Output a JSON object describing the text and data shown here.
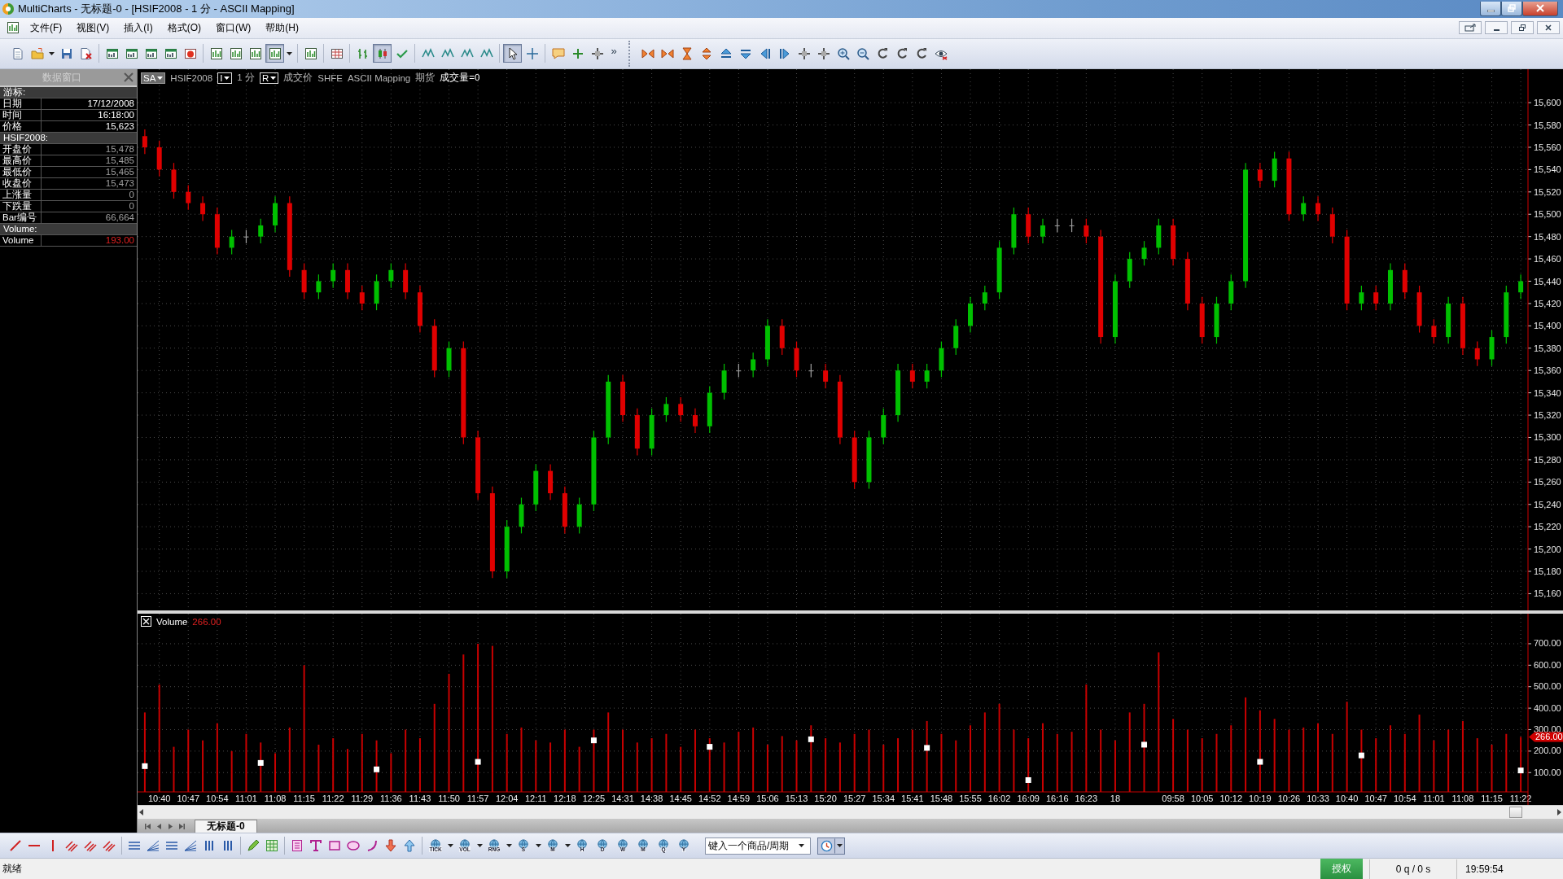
{
  "window": {
    "title": "MultiCharts - 无标题-0 - [HSIF2008 - 1 分 - ASCII Mapping]"
  },
  "menu": [
    "文件(F)",
    "视图(V)",
    "插入(I)",
    "格式(O)",
    "窗口(W)",
    "帮助(H)"
  ],
  "toolbars": [
    {
      "groups": [
        [
          {
            "kind": "document",
            "pressed": false
          },
          {
            "kind": "folder",
            "pressed": false
          },
          {
            "kind": "dropdown",
            "pressed": false
          },
          {
            "kind": "save",
            "pressed": false
          },
          {
            "kind": "close-doc",
            "pressed": false
          }
        ],
        [
          {
            "kind": "window",
            "pressed": false
          },
          {
            "kind": "window",
            "pressed": false
          },
          {
            "kind": "window",
            "pressed": false
          },
          {
            "kind": "window",
            "pressed": false
          },
          {
            "kind": "record",
            "pressed": false
          }
        ],
        [
          {
            "kind": "chart",
            "pressed": false
          },
          {
            "kind": "chart",
            "pressed": false
          },
          {
            "kind": "chart",
            "pressed": false
          },
          {
            "kind": "chart",
            "pressed": true
          },
          {
            "kind": "dropdown",
            "pressed": false
          }
        ],
        [
          {
            "kind": "chart",
            "pressed": false
          }
        ],
        [
          {
            "kind": "table",
            "pressed": false
          }
        ],
        [
          {
            "kind": "bars",
            "pressed": false
          },
          {
            "kind": "candles",
            "pressed": true
          },
          {
            "kind": "check",
            "pressed": false
          }
        ],
        [
          {
            "kind": "indicator",
            "pressed": false
          },
          {
            "kind": "indicator",
            "pressed": false
          },
          {
            "kind": "indicator",
            "pressed": false
          },
          {
            "kind": "indicator",
            "pressed": false
          }
        ],
        [
          {
            "kind": "pointer",
            "pressed": true
          },
          {
            "kind": "crosshair",
            "pressed": false
          }
        ],
        [
          {
            "kind": "comment",
            "pressed": false
          },
          {
            "kind": "plus",
            "pressed": false
          },
          {
            "kind": "move",
            "pressed": false
          },
          {
            "kind": "more",
            "label": "»",
            "pressed": false
          }
        ]
      ]
    },
    {
      "groups": [
        [
          {
            "kind": "arrows-in",
            "pressed": false
          },
          {
            "kind": "arrows-in",
            "pressed": false
          },
          {
            "kind": "hourglass",
            "pressed": false
          },
          {
            "kind": "expand",
            "pressed": false
          },
          {
            "kind": "up",
            "pressed": false
          },
          {
            "kind": "down",
            "pressed": false
          },
          {
            "kind": "left",
            "pressed": false
          },
          {
            "kind": "right",
            "pressed": false
          },
          {
            "kind": "move",
            "pressed": false
          },
          {
            "kind": "move",
            "pressed": false
          },
          {
            "kind": "zoom-in",
            "pressed": false
          },
          {
            "kind": "zoom-out",
            "pressed": false
          },
          {
            "kind": "rotate",
            "pressed": false
          },
          {
            "kind": "rotate",
            "pressed": false
          },
          {
            "kind": "rotate",
            "pressed": false
          },
          {
            "kind": "eye",
            "pressed": false
          }
        ]
      ]
    }
  ],
  "data_window": {
    "title": "数据窗口",
    "rows": [
      {
        "kind": "section",
        "label": "游标:"
      },
      {
        "kind": "row",
        "label": "日期",
        "value": "17/12/2008",
        "color": "#ffffff"
      },
      {
        "kind": "row",
        "label": "时间",
        "value": "16:18:00",
        "color": "#ffffff"
      },
      {
        "kind": "row",
        "label": "价格",
        "value": "15,623",
        "color": "#ffffff"
      },
      {
        "kind": "section",
        "label": "HSIF2008:"
      },
      {
        "kind": "row",
        "label": "开盘价",
        "value": "15,478",
        "color": "#a0a0a0"
      },
      {
        "kind": "row",
        "label": "最高价",
        "value": "15,485",
        "color": "#a0a0a0"
      },
      {
        "kind": "row",
        "label": "最低价",
        "value": "15,465",
        "color": "#a0a0a0"
      },
      {
        "kind": "row",
        "label": "收盘价",
        "value": "15,473",
        "color": "#a0a0a0"
      },
      {
        "kind": "row",
        "label": "上涨量",
        "value": "0",
        "color": "#a0a0a0"
      },
      {
        "kind": "row",
        "label": "下跌量",
        "value": "0",
        "color": "#a0a0a0"
      },
      {
        "kind": "row",
        "label": "Bar编号",
        "value": "66,664",
        "color": "#a0a0a0"
      },
      {
        "kind": "section",
        "label": "Volume:"
      },
      {
        "kind": "row",
        "label": "Volume",
        "value": "193.00",
        "color": "#e02020"
      }
    ]
  },
  "chart_header": {
    "session": "SA",
    "symbol": "HSIF2008",
    "interval_box": "I",
    "interval": "1 分",
    "range_box": "R",
    "field": "成交价",
    "exchange": "SHFE",
    "feed": "ASCII Mapping",
    "asset_type": "期货",
    "volume_status": "成交量=0"
  },
  "price_pane": {
    "chart_data": {
      "type": "candlestick",
      "grid": true,
      "ylim": [
        15145,
        15630
      ],
      "yticks": [
        {
          "value": 15160,
          "label": "15,160"
        },
        {
          "value": 15180,
          "label": "15,180"
        },
        {
          "value": 15200,
          "label": "15,200"
        },
        {
          "value": 15220,
          "label": "15,220"
        },
        {
          "value": 15240,
          "label": "15,240"
        },
        {
          "value": 15260,
          "label": "15,260"
        },
        {
          "value": 15280,
          "label": "15,280"
        },
        {
          "value": 15300,
          "label": "15,300"
        },
        {
          "value": 15320,
          "label": "15,320"
        },
        {
          "value": 15340,
          "label": "15,340"
        },
        {
          "value": 15360,
          "label": "15,360"
        },
        {
          "value": 15380,
          "label": "15,380"
        },
        {
          "value": 15400,
          "label": "15,400"
        },
        {
          "value": 15420,
          "label": "15,420"
        },
        {
          "value": 15440,
          "label": "15,440"
        },
        {
          "value": 15460,
          "label": "15,460"
        },
        {
          "value": 15480,
          "label": "15,480"
        },
        {
          "value": 15500,
          "label": "15,500"
        },
        {
          "value": 15520,
          "label": "15,520"
        },
        {
          "value": 15540,
          "label": "15,540"
        },
        {
          "value": 15560,
          "label": "15,560"
        },
        {
          "value": 15580,
          "label": "15,580"
        },
        {
          "value": 15600,
          "label": "15,600"
        }
      ],
      "categories": [
        null,
        null,
        null,
        null,
        null,
        null,
        null,
        null,
        null,
        null,
        null,
        null,
        null,
        null,
        null,
        null,
        null,
        null,
        null,
        null,
        null,
        null,
        null,
        null,
        null,
        null,
        null,
        null,
        null,
        null,
        null,
        null,
        null,
        null,
        null,
        null,
        null,
        null,
        null,
        null,
        null,
        null,
        null,
        null,
        null,
        null,
        null,
        null,
        null,
        null,
        null,
        null,
        null,
        null,
        null,
        null,
        null,
        null,
        null,
        null,
        null,
        null,
        null,
        null,
        null,
        null,
        null,
        null,
        null,
        null,
        null,
        null,
        null,
        null,
        null,
        null,
        null,
        null,
        null,
        null,
        null,
        null,
        null,
        null,
        null,
        null,
        null,
        null,
        null,
        null,
        null,
        null,
        null,
        null,
        null,
        null
      ],
      "ohlc": [
        [
          15570,
          15576,
          15554,
          15560
        ],
        [
          15560,
          15566,
          15534,
          15540
        ],
        [
          15540,
          15546,
          15514,
          15520
        ],
        [
          15520,
          15526,
          15504,
          15510
        ],
        [
          15510,
          15516,
          15494,
          15500
        ],
        [
          15500,
          15506,
          15464,
          15470
        ],
        [
          15470,
          15486,
          15464,
          15480
        ],
        [
          15480,
          15486,
          15474,
          15480
        ],
        [
          15480,
          15496,
          15474,
          15490
        ],
        [
          15490,
          15516,
          15484,
          15510
        ],
        [
          15510,
          15516,
          15444,
          15450
        ],
        [
          15450,
          15456,
          15424,
          15430
        ],
        [
          15430,
          15446,
          15424,
          15440
        ],
        [
          15440,
          15456,
          15434,
          15450
        ],
        [
          15450,
          15456,
          15424,
          15430
        ],
        [
          15430,
          15436,
          15414,
          15420
        ],
        [
          15420,
          15446,
          15414,
          15440
        ],
        [
          15440,
          15456,
          15434,
          15450
        ],
        [
          15450,
          15456,
          15424,
          15430
        ],
        [
          15430,
          15436,
          15394,
          15400
        ],
        [
          15400,
          15406,
          15354,
          15360
        ],
        [
          15360,
          15386,
          15354,
          15380
        ],
        [
          15380,
          15386,
          15294,
          15300
        ],
        [
          15300,
          15306,
          15244,
          15250
        ],
        [
          15250,
          15256,
          15174,
          15180
        ],
        [
          15180,
          15226,
          15174,
          15220
        ],
        [
          15220,
          15246,
          15214,
          15240
        ],
        [
          15240,
          15276,
          15234,
          15270
        ],
        [
          15270,
          15276,
          15244,
          15250
        ],
        [
          15250,
          15256,
          15214,
          15220
        ],
        [
          15220,
          15246,
          15214,
          15240
        ],
        [
          15240,
          15306,
          15234,
          15300
        ],
        [
          15300,
          15356,
          15294,
          15350
        ],
        [
          15350,
          15356,
          15314,
          15320
        ],
        [
          15320,
          15326,
          15284,
          15290
        ],
        [
          15290,
          15326,
          15284,
          15320
        ],
        [
          15320,
          15336,
          15314,
          15330
        ],
        [
          15330,
          15336,
          15314,
          15320
        ],
        [
          15320,
          15326,
          15304,
          15310
        ],
        [
          15310,
          15346,
          15304,
          15340
        ],
        [
          15340,
          15366,
          15334,
          15360
        ],
        [
          15360,
          15366,
          15354,
          15360
        ],
        [
          15360,
          15376,
          15354,
          15370
        ],
        [
          15370,
          15406,
          15364,
          15400
        ],
        [
          15400,
          15406,
          15374,
          15380
        ],
        [
          15380,
          15386,
          15354,
          15360
        ],
        [
          15360,
          15366,
          15354,
          15360
        ],
        [
          15360,
          15366,
          15344,
          15350
        ],
        [
          15350,
          15356,
          15294,
          15300
        ],
        [
          15300,
          15306,
          15254,
          15260
        ],
        [
          15260,
          15306,
          15254,
          15300
        ],
        [
          15300,
          15326,
          15294,
          15320
        ],
        [
          15320,
          15366,
          15314,
          15360
        ],
        [
          15360,
          15366,
          15344,
          15350
        ],
        [
          15350,
          15366,
          15344,
          15360
        ],
        [
          15360,
          15386,
          15354,
          15380
        ],
        [
          15380,
          15406,
          15374,
          15400
        ],
        [
          15400,
          15426,
          15394,
          15420
        ],
        [
          15420,
          15436,
          15414,
          15430
        ],
        [
          15430,
          15476,
          15424,
          15470
        ],
        [
          15470,
          15506,
          15464,
          15500
        ],
        [
          15500,
          15506,
          15474,
          15480
        ],
        [
          15480,
          15496,
          15474,
          15490
        ],
        [
          15490,
          15496,
          15484,
          15490
        ],
        [
          15490,
          15496,
          15484,
          15490
        ],
        [
          15490,
          15496,
          15474,
          15480
        ],
        [
          15480,
          15486,
          15384,
          15390
        ],
        [
          15390,
          15446,
          15384,
          15440
        ],
        [
          15440,
          15466,
          15434,
          15460
        ],
        [
          15460,
          15476,
          15454,
          15470
        ],
        [
          15470,
          15496,
          15464,
          15490
        ],
        [
          15490,
          15496,
          15454,
          15460
        ],
        [
          15460,
          15466,
          15414,
          15420
        ],
        [
          15420,
          15426,
          15384,
          15390
        ],
        [
          15390,
          15426,
          15384,
          15420
        ],
        [
          15420,
          15446,
          15414,
          15440
        ],
        [
          15440,
          15546,
          15434,
          15540
        ],
        [
          15540,
          15546,
          15524,
          15530
        ],
        [
          15530,
          15556,
          15524,
          15550
        ],
        [
          15550,
          15556,
          15494,
          15500
        ],
        [
          15500,
          15516,
          15494,
          15510
        ],
        [
          15510,
          15516,
          15494,
          15500
        ],
        [
          15500,
          15506,
          15474,
          15480
        ],
        [
          15480,
          15486,
          15414,
          15420
        ],
        [
          15420,
          15436,
          15414,
          15430
        ],
        [
          15430,
          15436,
          15414,
          15420
        ],
        [
          15420,
          15456,
          15414,
          15450
        ],
        [
          15450,
          15456,
          15424,
          15430
        ],
        [
          15430,
          15436,
          15394,
          15400
        ],
        [
          15400,
          15406,
          15384,
          15390
        ],
        [
          15390,
          15426,
          15384,
          15420
        ],
        [
          15420,
          15426,
          15374,
          15380
        ],
        [
          15380,
          15386,
          15364,
          15370
        ],
        [
          15370,
          15396,
          15364,
          15390
        ],
        [
          15390,
          15436,
          15384,
          15430
        ],
        [
          15430,
          15446,
          15424,
          15440
        ]
      ]
    }
  },
  "volume_pane": {
    "value": "266.00",
    "axis_tag": "266.00",
    "chart_data": {
      "type": "bar",
      "grid": true,
      "ylim": [
        10,
        840
      ],
      "categories": [
        null,
        "10:40",
        null,
        "10:47",
        null,
        "10:54",
        null,
        "11:01",
        null,
        "11:08",
        null,
        "11:15",
        null,
        "11:22",
        null,
        "11:29",
        null,
        "11:36",
        null,
        "11:43",
        null,
        "11:50",
        null,
        "11:57",
        null,
        "12:04",
        null,
        "12:11",
        null,
        "12:18",
        null,
        "12:25",
        null,
        "14:31",
        null,
        "14:38",
        null,
        "14:45",
        null,
        "14:52",
        null,
        "14:59",
        null,
        "15:06",
        null,
        "15:13",
        null,
        "15:20",
        null,
        "15:27",
        null,
        "15:34",
        null,
        "15:41",
        null,
        "15:48",
        null,
        "15:55",
        null,
        "16:02",
        null,
        "16:09",
        null,
        "16:16",
        null,
        "16:23",
        null,
        "18",
        null,
        null,
        null,
        "09:58",
        null,
        "10:05",
        null,
        "10:12",
        null,
        "10:19",
        null,
        "10:26",
        null,
        "10:33",
        null,
        "10:40",
        null,
        "10:47",
        null,
        "10:54",
        null,
        "11:01",
        null,
        "11:08",
        null,
        "11:15",
        null,
        "11:22"
      ],
      "yticks": [
        {
          "value": 100,
          "label": "100.00"
        },
        {
          "value": 200,
          "label": "200.00"
        },
        {
          "value": 300,
          "label": "300.00"
        },
        {
          "value": 400,
          "label": "400.00"
        },
        {
          "value": 500,
          "label": "500.00"
        },
        {
          "value": 600,
          "label": "600.00"
        },
        {
          "value": 700,
          "label": "700.00"
        }
      ],
      "series": [
        {
          "name": "Volume",
          "color": "#c80000",
          "values": [
            380,
            510,
            220,
            300,
            250,
            330,
            200,
            280,
            240,
            190,
            310,
            600,
            230,
            260,
            210,
            280,
            250,
            190,
            300,
            260,
            420,
            560,
            650,
            700,
            690,
            280,
            310,
            250,
            240,
            300,
            220,
            300,
            380,
            300,
            240,
            260,
            280,
            220,
            300,
            260,
            240,
            290,
            310,
            230,
            270,
            250,
            320,
            260,
            240,
            280,
            300,
            230,
            260,
            300,
            340,
            280,
            250,
            320,
            380,
            420,
            300,
            260,
            330,
            280,
            290,
            510,
            300,
            250,
            380,
            420,
            660,
            350,
            300,
            260,
            280,
            320,
            450,
            390,
            350,
            300,
            310,
            330,
            280,
            430,
            300,
            260,
            320,
            280,
            370,
            250,
            300,
            340,
            260,
            230,
            280,
            266
          ]
        },
        {
          "type": "scatter",
          "color": "#ffffff",
          "values": [
            130,
            null,
            null,
            null,
            null,
            null,
            null,
            null,
            145,
            null,
            null,
            null,
            null,
            null,
            null,
            null,
            115,
            null,
            null,
            null,
            null,
            null,
            null,
            150,
            null,
            null,
            null,
            null,
            null,
            null,
            null,
            250,
            null,
            null,
            null,
            null,
            null,
            null,
            null,
            220,
            null,
            null,
            null,
            null,
            null,
            null,
            255,
            null,
            null,
            null,
            null,
            null,
            null,
            null,
            215,
            null,
            null,
            null,
            null,
            null,
            null,
            65,
            null,
            null,
            null,
            null,
            null,
            null,
            null,
            230,
            null,
            null,
            null,
            null,
            null,
            null,
            null,
            150,
            null,
            null,
            null,
            null,
            null,
            null,
            180,
            null,
            null,
            null,
            null,
            null,
            null,
            null,
            null,
            null,
            null,
            110
          ]
        }
      ]
    }
  },
  "tabs": [
    {
      "label": "无标题-0",
      "selected": true
    }
  ],
  "drawing_toolbar": {
    "groups": [
      [
        {
          "kind": "line"
        },
        {
          "kind": "hline"
        },
        {
          "kind": "vline"
        },
        {
          "kind": "parallel"
        },
        {
          "kind": "parallel"
        },
        {
          "kind": "parallel"
        }
      ],
      [
        {
          "kind": "hlines"
        },
        {
          "kind": "fan"
        },
        {
          "kind": "hlines"
        },
        {
          "kind": "fan"
        },
        {
          "kind": "vbars"
        },
        {
          "kind": "vbars"
        }
      ],
      [
        {
          "kind": "pencil"
        },
        {
          "kind": "grid"
        }
      ],
      [
        {
          "kind": "textbox"
        },
        {
          "kind": "text"
        },
        {
          "kind": "rect"
        },
        {
          "kind": "ellipse"
        },
        {
          "kind": "arc"
        },
        {
          "kind": "arrow-down"
        },
        {
          "kind": "arrow-up"
        }
      ],
      [
        {
          "kind": "resolution",
          "label": "TICK"
        },
        {
          "kind": "dropdown"
        },
        {
          "kind": "resolution",
          "label": "VOL"
        },
        {
          "kind": "dropdown"
        },
        {
          "kind": "resolution",
          "label": "RNG"
        },
        {
          "kind": "dropdown"
        },
        {
          "kind": "resolution",
          "label": "S"
        },
        {
          "kind": "dropdown"
        },
        {
          "kind": "resolution",
          "label": "M"
        },
        {
          "kind": "dropdown"
        },
        {
          "kind": "resolution",
          "label": "H"
        },
        {
          "kind": "resolution",
          "label": "D"
        },
        {
          "kind": "resolution",
          "label": "W"
        },
        {
          "kind": "resolution",
          "label": "M"
        },
        {
          "kind": "resolution",
          "label": "Q"
        },
        {
          "kind": "resolution",
          "label": "Y"
        }
      ]
    ]
  },
  "symbol_field": {
    "placeholder": "键入一个商品/周期"
  },
  "status_bar": {
    "message": "就绪",
    "license": "授权",
    "queue": "0 q / 0 s",
    "time": "19:59:54"
  }
}
